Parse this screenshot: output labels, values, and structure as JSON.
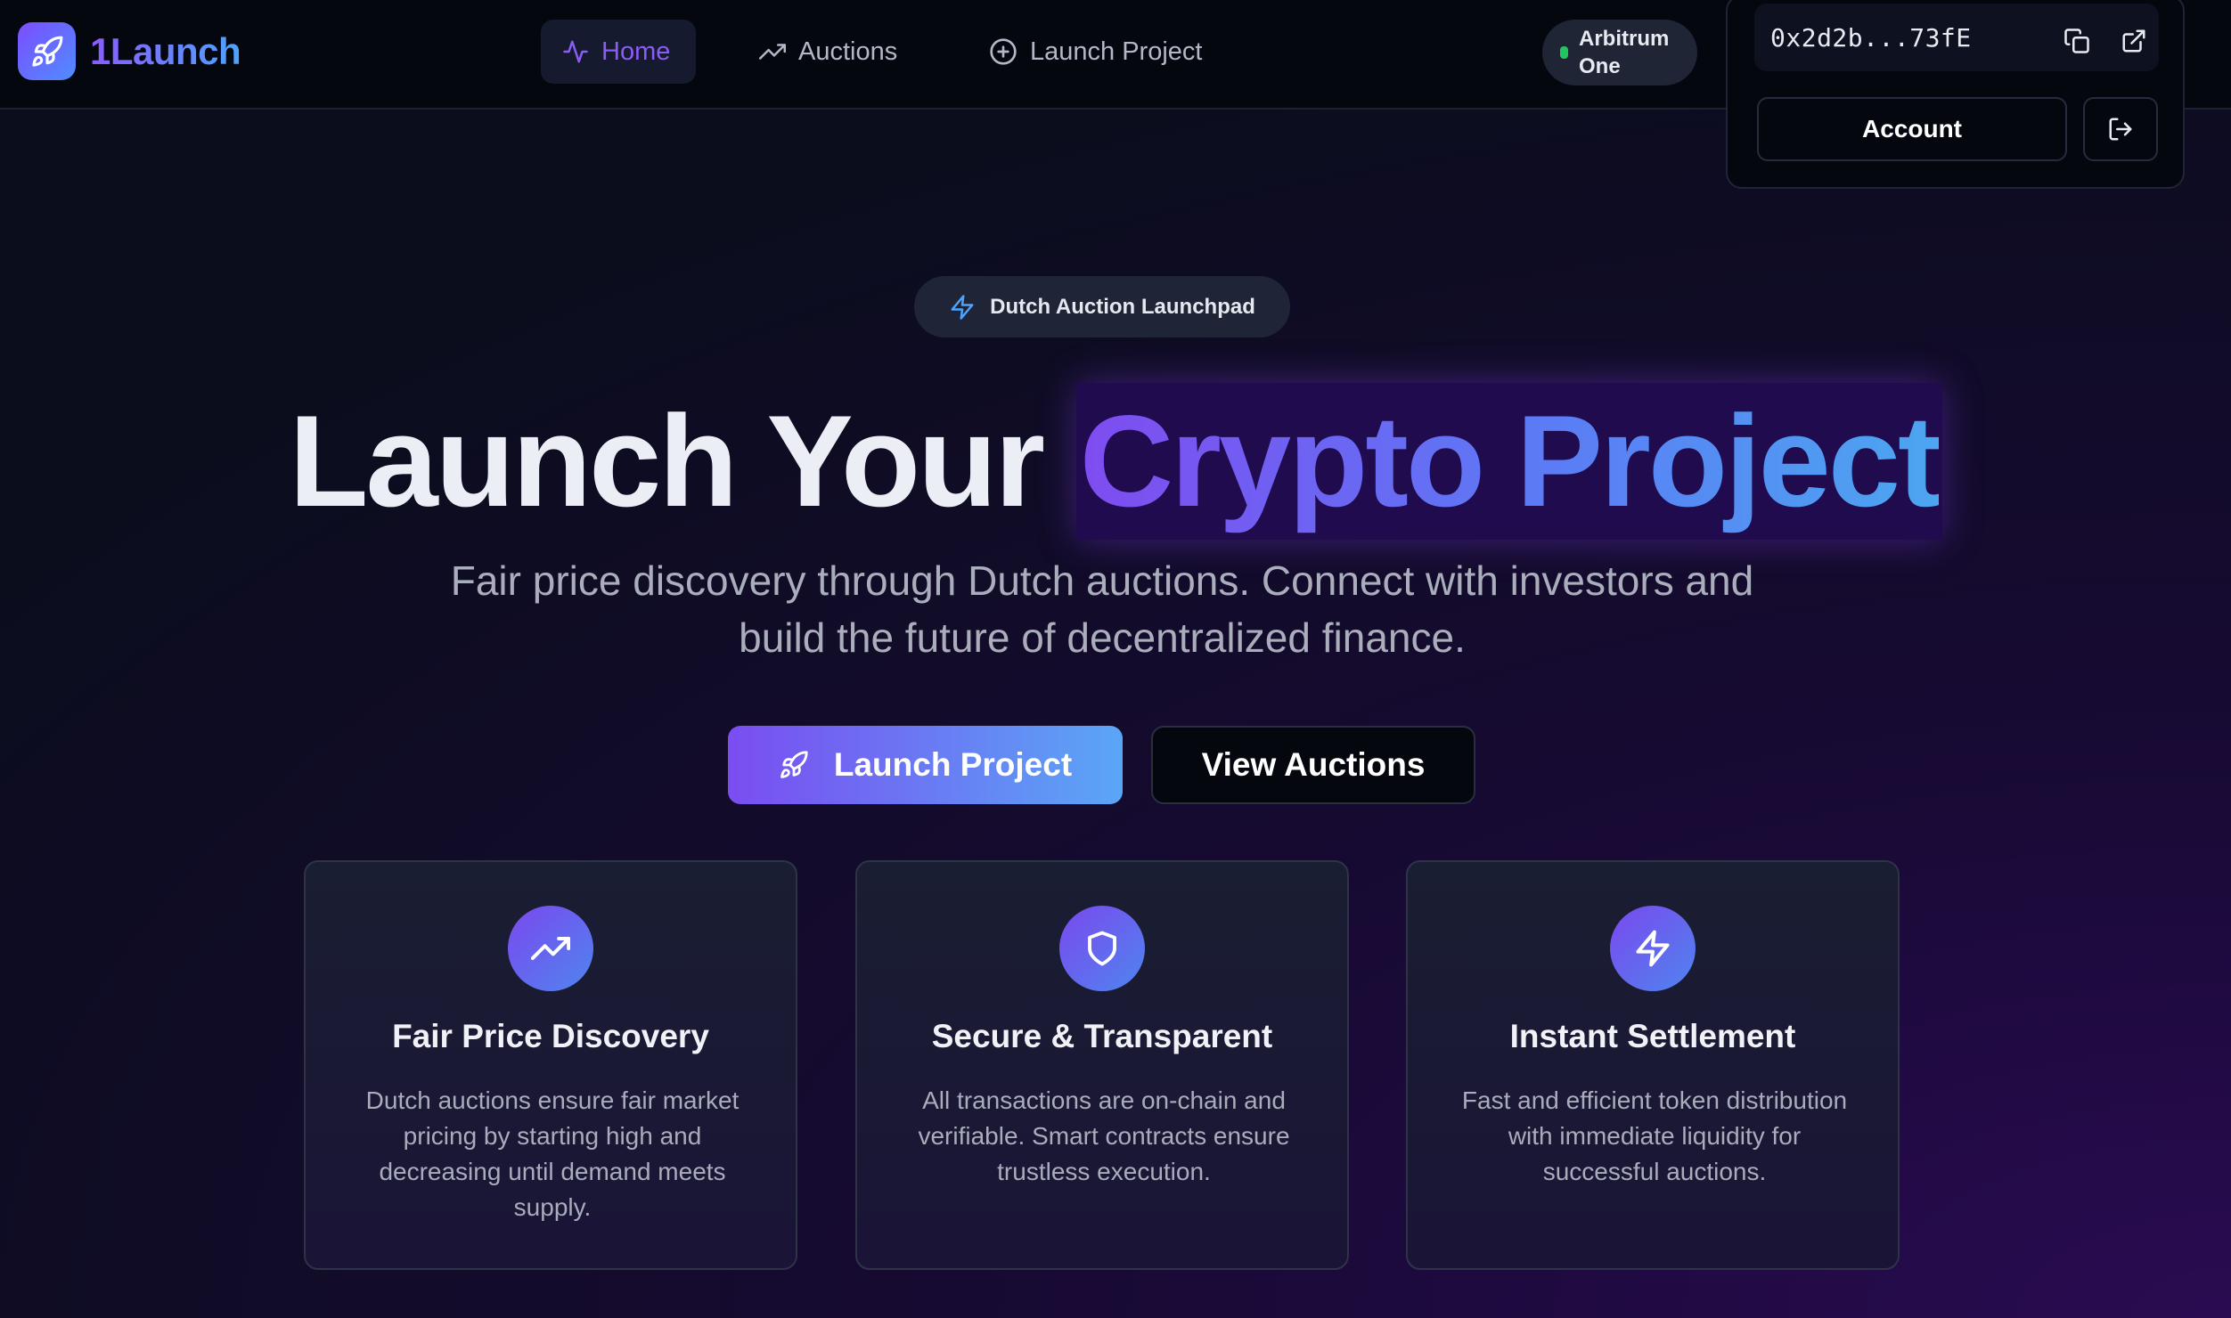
{
  "header": {
    "brand_name": "1Launch",
    "nav": [
      {
        "label": "Home",
        "icon": "activity-icon",
        "active": true
      },
      {
        "label": "Auctions",
        "icon": "trending-up-icon",
        "active": false
      },
      {
        "label": "Launch Project",
        "icon": "plus-circle-icon",
        "active": false
      }
    ],
    "network": {
      "line1": "Arbitrum",
      "line2": "One",
      "status_color": "#22c55e"
    },
    "wallet": {
      "address": "0x2d2b...73fE",
      "account_label": "Account"
    }
  },
  "hero": {
    "badge": "Dutch Auction Launchpad",
    "title_plain": "Launch Your",
    "title_highlight": "Crypto Project",
    "subtitle_line1": "Fair price discovery through Dutch auctions. Connect with investors and",
    "subtitle_line2": "build the future of decentralized finance.",
    "primary_cta": "Launch Project",
    "secondary_cta": "View Auctions"
  },
  "features": [
    {
      "icon": "trending-up-icon",
      "title": "Fair Price Discovery",
      "desc": "Dutch auctions ensure fair market pricing by starting high and decreasing until demand meets supply."
    },
    {
      "icon": "shield-icon",
      "title": "Secure & Transparent",
      "desc": "All transactions are on-chain and verifiable. Smart contracts ensure trustless execution."
    },
    {
      "icon": "zap-icon",
      "title": "Instant Settlement",
      "desc": "Fast and efficient token distribution with immediate liquidity for successful auctions."
    }
  ],
  "colors": {
    "accent_purple": "#7c4dff",
    "accent_blue": "#4da3ff",
    "background": "#0b0d1d"
  }
}
